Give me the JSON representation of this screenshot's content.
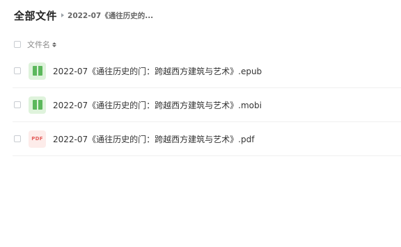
{
  "breadcrumb": {
    "root": "全部文件",
    "current": "2022-07《通往历史的..."
  },
  "list_header": {
    "column_name": "文件名"
  },
  "files": [
    {
      "name": "2022-07《通往历史的门：跨越西方建筑与艺术》.epub",
      "icon": "ebook-icon"
    },
    {
      "name": "2022-07《通往历史的门：跨越西方建筑与艺术》.mobi",
      "icon": "ebook-icon"
    },
    {
      "name": "2022-07《通往历史的门：跨越西方建筑与艺术》.pdf",
      "icon": "pdf-icon",
      "icon_label": "PDF"
    }
  ],
  "colors": {
    "ebook_icon_bg": "#dff3dc",
    "ebook_icon_fg": "#5cb85c",
    "pdf_icon_bg": "#fdecea",
    "pdf_icon_fg": "#e35d5b"
  }
}
